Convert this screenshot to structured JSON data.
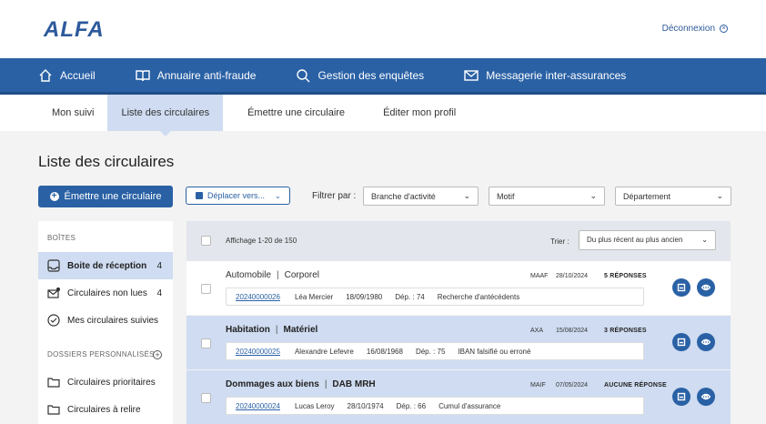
{
  "header": {
    "logo": "ALFA",
    "logout_label": "Déconnexion"
  },
  "nav": {
    "items": [
      {
        "label": "Accueil",
        "icon": "home-icon"
      },
      {
        "label": "Annuaire anti-fraude",
        "icon": "book-icon"
      },
      {
        "label": "Gestion des enquêtes",
        "icon": "search-icon"
      },
      {
        "label": "Messagerie inter-assurances",
        "icon": "mail-icon"
      }
    ]
  },
  "subnav": {
    "items": [
      "Mon suivi",
      "Liste des circulaires",
      "Émettre une circulaire",
      "Éditer mon profil"
    ],
    "active": "Liste des circulaires"
  },
  "page": {
    "title": "Liste des circulaires"
  },
  "toolbar": {
    "emit_label": "Émettre une circulaire",
    "move_label": "Déplacer vers...",
    "filter_label": "Filtrer par :",
    "filters": [
      "Branche d'activité",
      "Motif",
      "Département"
    ]
  },
  "sidebar": {
    "boxes_header": "BOÎTES",
    "boxes": [
      {
        "label": "Boite de réception",
        "count": "4",
        "icon": "inbox-icon"
      },
      {
        "label": "Circulaires non lues",
        "count": "4",
        "icon": "unread-mail-icon"
      },
      {
        "label": "Mes circulaires suivies",
        "count": "",
        "icon": "check-circle-icon"
      }
    ],
    "folders_header": "DOSSIERS PERSONNALISÉS",
    "folders": [
      {
        "label": "Circulaires prioritaires",
        "icon": "folder-icon"
      },
      {
        "label": "Circulaires à relire",
        "icon": "folder-icon"
      }
    ]
  },
  "list": {
    "display_label": "Affichage 1-20 de 150",
    "sort_label": "Trier :",
    "sort_value": "Du plus récent au plus ancien",
    "rows": [
      {
        "category": "Automobile",
        "subcategory": "Corporel",
        "insurer": "MAAF",
        "date": "28/10/2024",
        "responses": "5 RÉPONSES",
        "ref": "20240000026",
        "name": "Léa Mercier",
        "birthdate": "18/09/1980",
        "dept": "Dép. : 74",
        "reason": "Recherche d'antécédents",
        "highlighted": false
      },
      {
        "category": "Habitation",
        "subcategory": "Matériel",
        "insurer": "AXA",
        "date": "15/08/2024",
        "responses": "3 RÉPONSES",
        "ref": "20240000025",
        "name": "Alexandre Lefevre",
        "birthdate": "16/08/1968",
        "dept": "Dép. : 75",
        "reason": "IBAN falsifié ou erroné",
        "highlighted": true
      },
      {
        "category": "Dommages aux biens",
        "subcategory": "DAB MRH",
        "insurer": "MAIF",
        "date": "07/05/2024",
        "responses": "AUCUNE RÉPONSE",
        "ref": "20240000024",
        "name": "Lucas Leroy",
        "birthdate": "28/10/1974",
        "dept": "Dép. : 66",
        "reason": "Cumul d'assurance",
        "highlighted": true
      }
    ]
  },
  "colors": {
    "primary": "#2a61a5",
    "highlight": "#cfdcf1",
    "background": "#f3f3f3"
  }
}
